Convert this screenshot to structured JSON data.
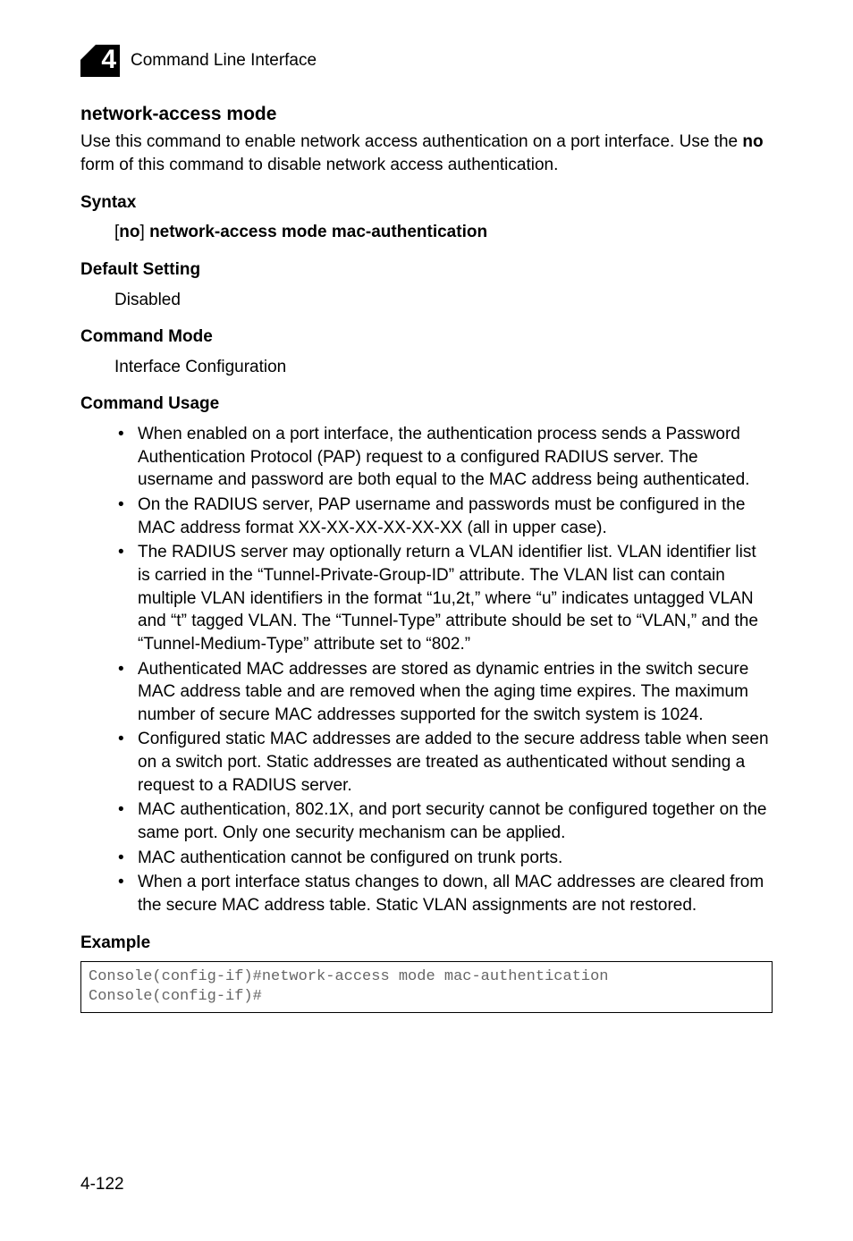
{
  "header": {
    "chapter_number": "4",
    "running_title": "Command Line Interface"
  },
  "section": {
    "title": "network-access mode",
    "intro_a": "Use this command to enable network access authentication on a port interface. Use the ",
    "intro_no": "no",
    "intro_b": " form of this command to disable network access authentication."
  },
  "syntax": {
    "label": "Syntax",
    "prefix_br": "[",
    "no": "no",
    "suffix_br": "] ",
    "cmd": "network-access mode mac-authentication"
  },
  "default_setting": {
    "label": "Default Setting",
    "value": "Disabled"
  },
  "command_mode": {
    "label": "Command Mode",
    "value": "Interface Configuration"
  },
  "usage": {
    "label": "Command Usage",
    "items": [
      "When enabled on a port interface, the authentication process sends a Password Authentication Protocol (PAP) request to a configured RADIUS server. The username and password are both equal to the MAC address being authenticated.",
      "On the RADIUS server, PAP username and passwords must be configured in the MAC address format XX-XX-XX-XX-XX-XX (all in upper case).",
      "The RADIUS server may optionally return a VLAN identifier list. VLAN identifier list is carried in the “Tunnel-Private-Group-ID” attribute. The VLAN list can contain multiple VLAN identifiers in the format “1u,2t,” where “u” indicates untagged VLAN and “t” tagged VLAN. The “Tunnel-Type” attribute should be set to “VLAN,” and the “Tunnel-Medium-Type” attribute set to “802.”",
      "Authenticated MAC addresses are stored as dynamic entries in the switch secure MAC address table and are removed when the aging time expires. The maximum number of secure MAC addresses supported for the switch system is 1024.",
      "Configured static MAC addresses are added to the secure address table when seen on a switch port. Static addresses are treated as authenticated without sending a request to a RADIUS server.",
      "MAC authentication, 802.1X, and port security cannot be configured together on the same port. Only one security mechanism can be applied.",
      "MAC authentication cannot be configured on trunk ports.",
      "When a port interface status changes to down, all MAC addresses are cleared from the secure MAC address table. Static VLAN assignments are not restored."
    ]
  },
  "example": {
    "label": "Example",
    "code": "Console(config-if)#network-access mode mac-authentication\nConsole(config-if)#"
  },
  "footer": {
    "page_number": "4-122"
  }
}
